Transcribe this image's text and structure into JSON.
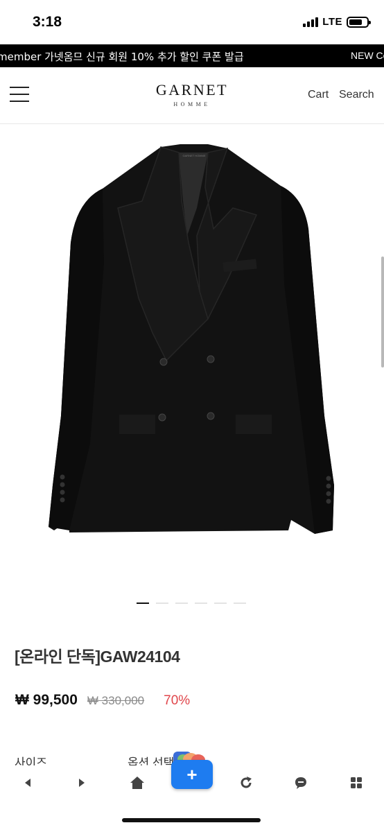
{
  "status_bar": {
    "time": "3:18",
    "network": "LTE",
    "battery_level": 0.75
  },
  "promo_banner": {
    "text": "member 가넷옴므 신규 회원 10% 추가 할인 쿠폰 발급",
    "next_text": "NEW Co"
  },
  "header": {
    "logo_main": "GARNET",
    "logo_sub": "HOMME",
    "cart_label": "Cart",
    "search_label": "Search",
    "menu_icon": "hamburger-icon"
  },
  "product": {
    "image": "black double-breasted blazer",
    "jacket_label": "GARNET HOMME",
    "gallery_total": 6,
    "gallery_active": 1,
    "title": "[온라인 단독]GAW24104",
    "price": "₩ 99,500",
    "original_price": "₩ 330,000",
    "discount": "70%",
    "options": {
      "size_label": "사이즈",
      "color_label": "옵션 선택"
    }
  },
  "toolbar": {
    "icons": [
      "back-icon",
      "forward-icon",
      "home-icon",
      "add-icon",
      "refresh-icon",
      "chat-icon",
      "grid-icon"
    ],
    "fab_label": "+"
  },
  "colors": {
    "accent_discount": "#e0464b",
    "fab_blue": "#1e7cf0",
    "banner_bg": "#000000"
  }
}
